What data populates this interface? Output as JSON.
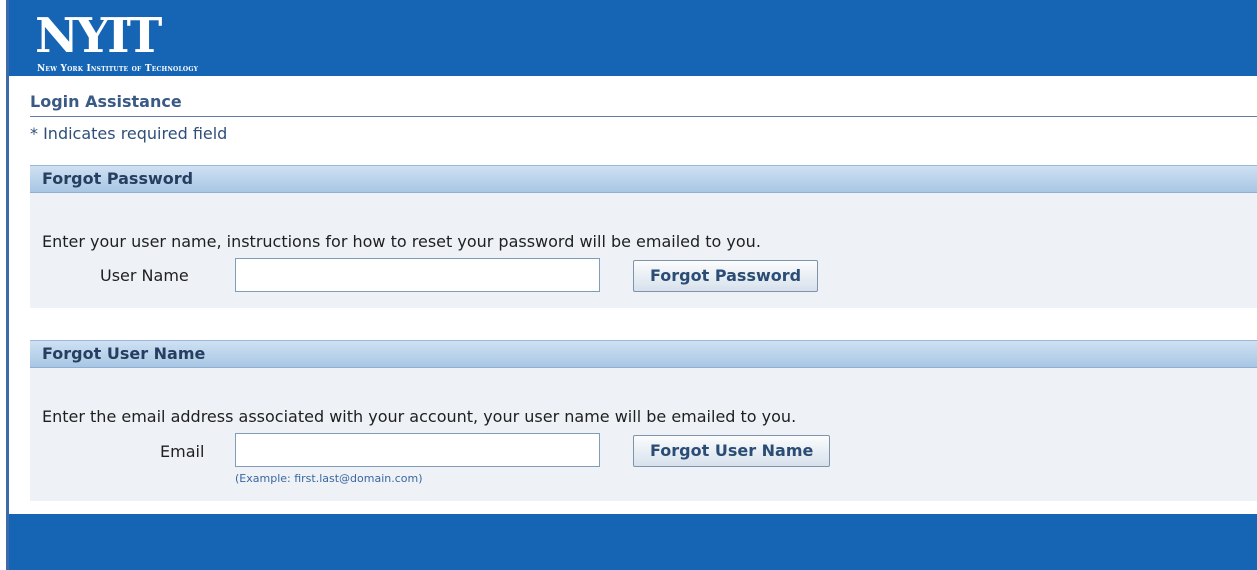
{
  "brand": {
    "logo_text": "NYIT",
    "subtitle": "New York Institute of Technology"
  },
  "page": {
    "title": "Login Assistance",
    "required_note": "* Indicates required field"
  },
  "forgot_password": {
    "header": "Forgot Password",
    "instructions": "Enter your user name, instructions for how to reset your password will be emailed to you.",
    "field_label": "User Name",
    "field_value": "",
    "button_label": "Forgot Password"
  },
  "forgot_username": {
    "header": "Forgot User Name",
    "instructions": "Enter the email address associated with your account, your user name will be emailed to you.",
    "field_label": "Email",
    "field_value": "",
    "hint": "(Example: first.last@domain.com)",
    "button_label": "Forgot User Name"
  },
  "colors": {
    "brand_blue": "#1565b4",
    "section_header_top": "#cfe1f3",
    "section_header_bottom": "#a8c6e4",
    "section_body": "#eef1f6",
    "title_text": "#3a5a86"
  }
}
